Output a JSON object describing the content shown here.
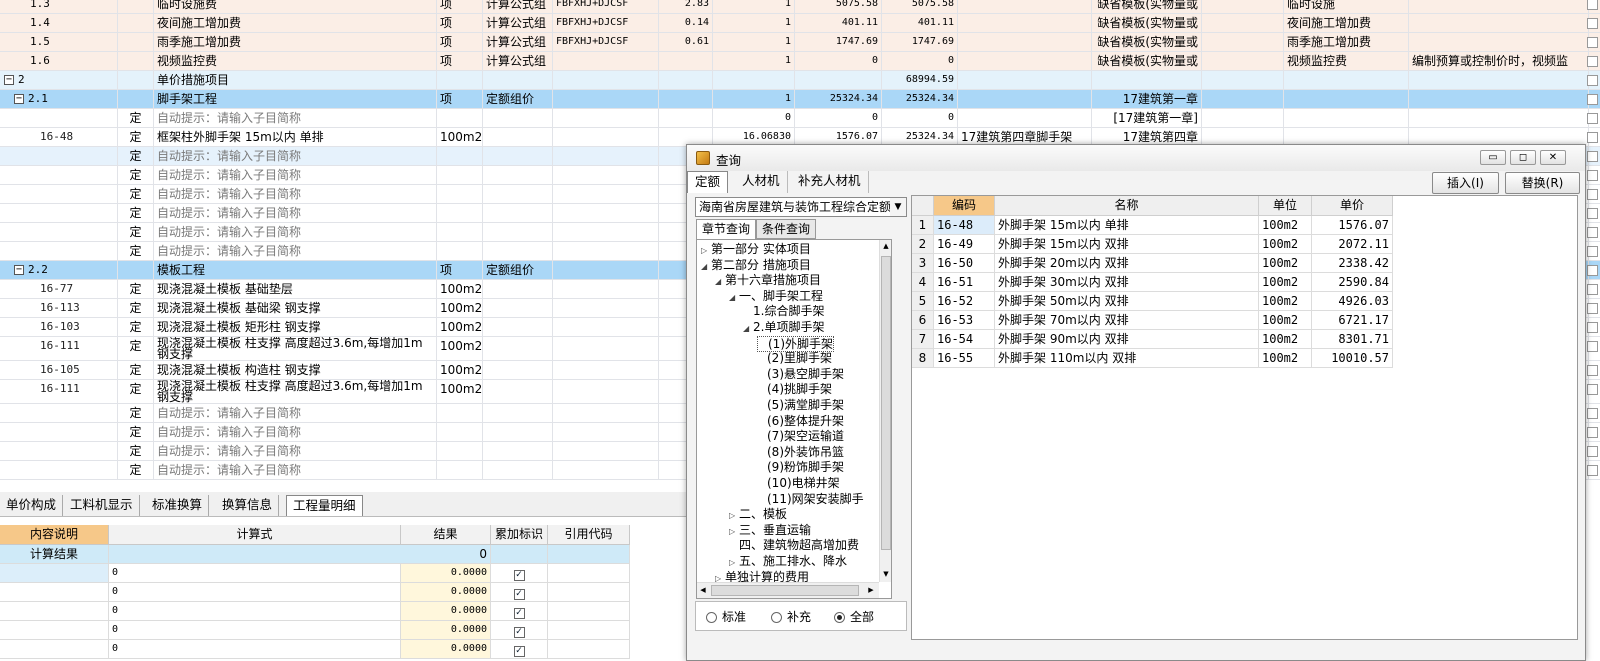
{
  "colors": {
    "accent": "#aad7f7",
    "row_head": "#fbeee6",
    "selected": "#9cd0f2",
    "hint_row": "#e6f2fc"
  },
  "main_rows": [
    {
      "c0": "1.3",
      "c2": "临时设施费",
      "c3": "项",
      "c4": "计算公式组",
      "c5": "FBFXHJ+DJCSF",
      "c6": "2.83",
      "c7": "1",
      "c8": "5075.58",
      "c9": "5075.58",
      "c10": "",
      "c11": "缺省模板(实物量或",
      "c12": "",
      "c13": "临时设施",
      "c14": "",
      "type": "sub"
    },
    {
      "c0": "1.4",
      "c2": "夜间施工增加费",
      "c3": "项",
      "c4": "计算公式组",
      "c5": "FBFXHJ+DJCSF",
      "c6": "0.14",
      "c7": "1",
      "c8": "401.11",
      "c9": "401.11",
      "c10": "",
      "c11": "缺省模板(实物量或",
      "c12": "",
      "c13": "夜间施工增加费",
      "c14": "",
      "type": "sub"
    },
    {
      "c0": "1.5",
      "c2": "雨季施工增加费",
      "c3": "项",
      "c4": "计算公式组",
      "c5": "FBFXHJ+DJCSF",
      "c6": "0.61",
      "c7": "1",
      "c8": "1747.69",
      "c9": "1747.69",
      "c10": "",
      "c11": "缺省模板(实物量或",
      "c12": "",
      "c13": "雨季施工增加费",
      "c14": "",
      "type": "sub"
    },
    {
      "c0": "1.6",
      "c2": "视频监控费",
      "c3": "项",
      "c4": "计算公式组",
      "c5": "",
      "c6": "",
      "c7": "1",
      "c8": "0",
      "c9": "0",
      "c10": "",
      "c11": "缺省模板(实物量或",
      "c12": "",
      "c13": "视频监控费",
      "c14": "编制预算或控制价时，视频监",
      "type": "sub"
    },
    {
      "c0": "2",
      "c2": "单价措施项目",
      "c3": "",
      "c4": "",
      "c5": "",
      "c6": "",
      "c7": "",
      "c8": "",
      "c9": "68994.59",
      "c10": "",
      "c11": "",
      "c12": "",
      "c13": "",
      "c14": "",
      "type": "group"
    },
    {
      "c0": "2.1",
      "c2": "脚手架工程",
      "c3": "项",
      "c4": "定额组价",
      "c5": "",
      "c6": "",
      "c7": "1",
      "c8": "25324.34",
      "c9": "25324.34",
      "c10": "",
      "c11": "17建筑第一章",
      "c12": "",
      "c13": "",
      "c14": "",
      "type": "selected"
    },
    {
      "c0": "",
      "c1": "定",
      "c2": "自动提示：请输入子目简称",
      "c3": "",
      "c4": "",
      "c5": "",
      "c6": "",
      "c7": "0",
      "c8": "0",
      "c9": "0",
      "c10": "",
      "c11": "[17建筑第一章]",
      "c12": "",
      "c13": "",
      "c14": "",
      "type": "hint"
    },
    {
      "c0": "16-48",
      "c1": "定",
      "c2": "框架柱外脚手架 15m以内 单排",
      "c3": "100m2",
      "c4": "",
      "c5": "",
      "c6": "",
      "c7": "16.06830",
      "c8": "1576.07",
      "c9": "25324.34",
      "c10": "17建筑第四章脚手架",
      "c11": "17建筑第四章",
      "c12": "",
      "c13": "",
      "c14": "",
      "type": "item"
    },
    {
      "c0": "",
      "c1": "定",
      "c2": "自动提示：请输入子目简称",
      "type": "hintblue"
    },
    {
      "c0": "",
      "c1": "定",
      "c2": "自动提示：请输入子目简称",
      "type": "hint"
    },
    {
      "c0": "",
      "c1": "定",
      "c2": "自动提示：请输入子目简称",
      "type": "hint"
    },
    {
      "c0": "",
      "c1": "定",
      "c2": "自动提示：请输入子目简称",
      "type": "hint"
    },
    {
      "c0": "",
      "c1": "定",
      "c2": "自动提示：请输入子目简称",
      "type": "hint"
    },
    {
      "c0": "",
      "c1": "定",
      "c2": "自动提示：请输入子目简称",
      "type": "hint"
    },
    {
      "c0": "2.2",
      "c2": "模板工程",
      "c3": "项",
      "c4": "定额组价",
      "type": "selected"
    },
    {
      "c0": "16-77",
      "c1": "定",
      "c2": "现浇混凝土模板 基础垫层",
      "c3": "100m2",
      "type": "item"
    },
    {
      "c0": "16-113",
      "c1": "定",
      "c2": "现浇混凝土模板 基础梁 钢支撑",
      "c3": "100m2",
      "type": "item"
    },
    {
      "c0": "16-103",
      "c1": "定",
      "c2": "现浇混凝土模板 矩形柱 钢支撑",
      "c3": "100m2",
      "type": "item"
    },
    {
      "c0": "16-111",
      "c1": "定",
      "c2": "现浇混凝土模板 柱支撑 高度超过3.6m,每增加1m 钢支撑",
      "c3": "100m2",
      "type": "item2"
    },
    {
      "c0": "16-105",
      "c1": "定",
      "c2": "现浇混凝土模板 构造柱 钢支撑",
      "c3": "100m2",
      "type": "item"
    },
    {
      "c0": "16-111",
      "c1": "定",
      "c2": "现浇混凝土模板 柱支撑 高度超过3.6m,每增加1m 钢支撑",
      "c3": "100m2",
      "type": "item2"
    },
    {
      "c0": "",
      "c1": "定",
      "c2": "自动提示：请输入子目简称",
      "type": "hint"
    },
    {
      "c0": "",
      "c1": "定",
      "c2": "自动提示：请输入子目简称",
      "type": "hint"
    },
    {
      "c0": "",
      "c1": "定",
      "c2": "自动提示：请输入子目简称",
      "type": "hint"
    },
    {
      "c0": "",
      "c1": "定",
      "c2": "自动提示：请输入子目简称",
      "type": "hint"
    }
  ],
  "bottom": {
    "tabs": [
      "单价构成",
      "工料机显示",
      "标准换算",
      "换算信息",
      "工程量明细"
    ],
    "headers": [
      "内容说明",
      "计算式",
      "结果",
      "累加标识",
      "引用代码"
    ],
    "result_row": {
      "label": "计算结果",
      "value": "0"
    },
    "rows": [
      {
        "expr": "0",
        "result": "0.0000"
      },
      {
        "expr": "0",
        "result": "0.0000"
      },
      {
        "expr": "0",
        "result": "0.0000"
      },
      {
        "expr": "0",
        "result": "0.0000"
      },
      {
        "expr": "0",
        "result": "0.0000"
      }
    ]
  },
  "dialog": {
    "title": "查询",
    "tabs": [
      "定额",
      "人材机",
      "补充人材机"
    ],
    "insert_label": "插入(I)",
    "replace_label": "替换(R)",
    "combo": "海南省房屋建筑与装饰工程综合定额",
    "subtabs": [
      "章节查询",
      "条件查询"
    ],
    "tree": [
      "第一部分 实体项目",
      "第二部分 措施项目",
      "第十六章措施项目",
      "一、脚手架工程",
      "1.综合脚手架",
      "2.单项脚手架",
      "(1)外脚手架",
      "(2)里脚手架",
      "(3)悬空脚手架",
      "(4)挑脚手架",
      "(5)满堂脚手架",
      "(6)整体提升架",
      "(7)架空运输道",
      "(8)外装饰吊篮",
      "(9)粉饰脚手架",
      "(10)电梯井架",
      "(11)网架安装脚手",
      "二、模板",
      "三、垂直运输",
      "四、建筑物超高增加费",
      "五、施工排水、降水",
      "单独计算的费用"
    ],
    "radios": [
      "标准",
      "补充",
      "全部"
    ],
    "headers": [
      "",
      "编码",
      "名称",
      "单位",
      "单价"
    ],
    "rows": [
      {
        "n": "1",
        "code": "16-48",
        "name": "外脚手架 15m以内 单排",
        "unit": "100m2",
        "price": "1576.07"
      },
      {
        "n": "2",
        "code": "16-49",
        "name": "外脚手架 15m以内 双排",
        "unit": "100m2",
        "price": "2072.11"
      },
      {
        "n": "3",
        "code": "16-50",
        "name": "外脚手架 20m以内 双排",
        "unit": "100m2",
        "price": "2338.42"
      },
      {
        "n": "4",
        "code": "16-51",
        "name": "外脚手架 30m以内 双排",
        "unit": "100m2",
        "price": "2590.84"
      },
      {
        "n": "5",
        "code": "16-52",
        "name": "外脚手架 50m以内 双排",
        "unit": "100m2",
        "price": "4926.03"
      },
      {
        "n": "6",
        "code": "16-53",
        "name": "外脚手架 70m以内 双排",
        "unit": "100m2",
        "price": "6721.17"
      },
      {
        "n": "7",
        "code": "16-54",
        "name": "外脚手架 90m以内 双排",
        "unit": "100m2",
        "price": "8301.71"
      },
      {
        "n": "8",
        "code": "16-55",
        "name": "外脚手架 110m以内 双排",
        "unit": "100m2",
        "price": "10010.57"
      }
    ]
  }
}
